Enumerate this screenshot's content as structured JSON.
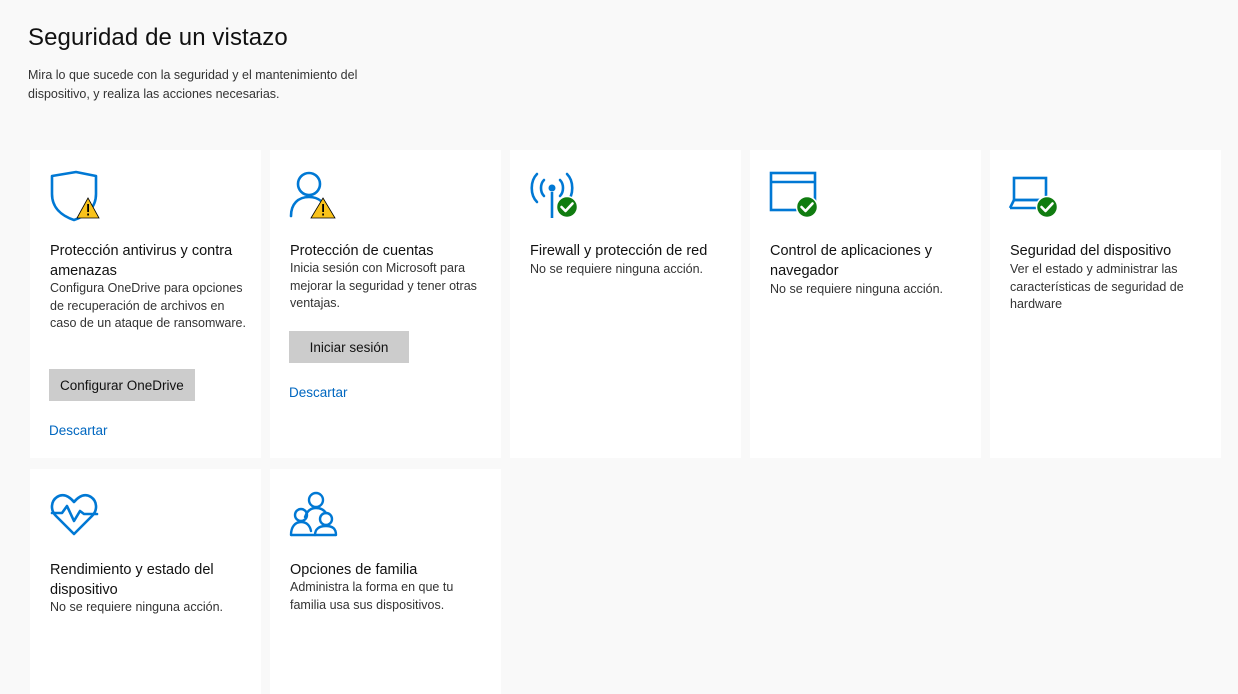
{
  "header": {
    "title": "Seguridad de un vistazo",
    "subtitle": "Mira lo que sucede con la seguridad y el mantenimiento del dispositivo, y realiza las acciones necesarias."
  },
  "colors": {
    "accent": "#0067c0",
    "ok": "#107c10",
    "warning": "#f9c21b",
    "icon_blue": "#0078d4"
  },
  "cards": [
    {
      "icon": "shield-warning-icon",
      "status": "warning",
      "title": "Protección antivirus y contra amenazas",
      "description": "Configura OneDrive para opciones de recuperación de archivos en caso de un ataque de ransomware.",
      "button": "Configurar OneDrive",
      "link": "Descartar"
    },
    {
      "icon": "account-warning-icon",
      "status": "warning",
      "title": "Protección de cuentas",
      "description": "Inicia sesión con Microsoft para mejorar la seguridad y tener otras ventajas.",
      "button": "Iniciar sesión",
      "link": "Descartar"
    },
    {
      "icon": "firewall-ok-icon",
      "status": "ok",
      "title": "Firewall y protección de red",
      "description": "No se requiere ninguna acción."
    },
    {
      "icon": "app-browser-ok-icon",
      "status": "ok",
      "title": "Control de aplicaciones y navegador",
      "description": "No se requiere ninguna acción."
    },
    {
      "icon": "laptop-ok-icon",
      "status": "ok",
      "title": "Seguridad del dispositivo",
      "description": "Ver el estado y administrar las características de seguridad de hardware"
    },
    {
      "icon": "heart-pulse-icon",
      "status": "none",
      "title": "Rendimiento y estado del dispositivo",
      "description": "No se requiere ninguna acción."
    },
    {
      "icon": "family-icon",
      "status": "none",
      "title": "Opciones de familia",
      "description": "Administra la forma en que tu familia usa sus dispositivos."
    }
  ]
}
